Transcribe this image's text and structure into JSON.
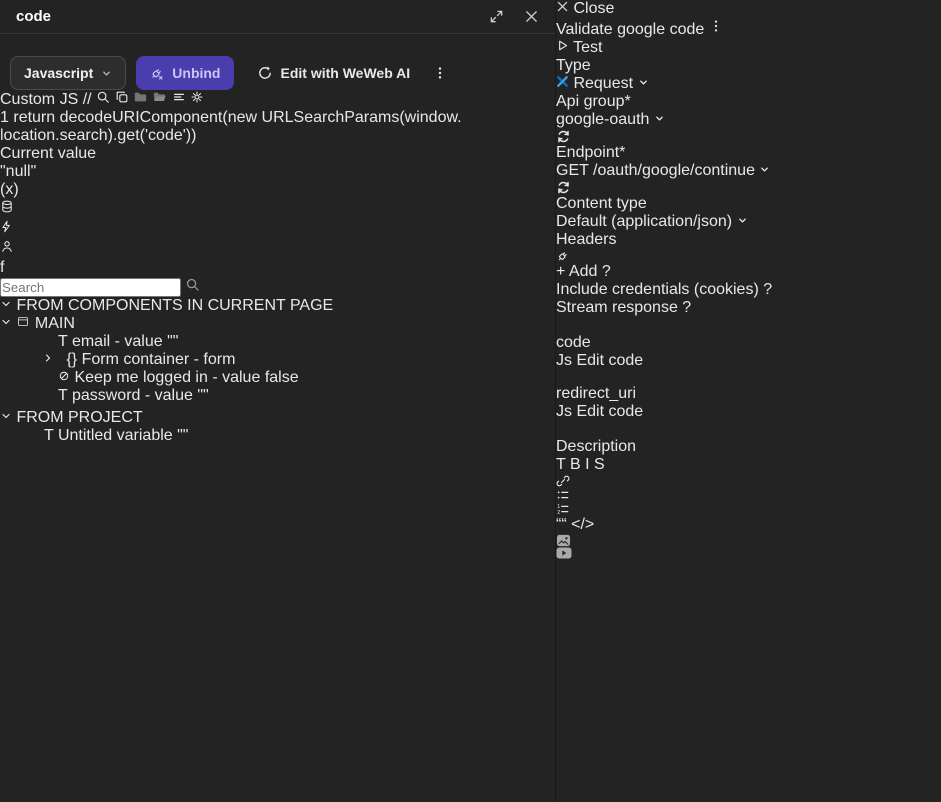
{
  "left_panel": {
    "header": {
      "title": "code"
    },
    "toolbar": {
      "language": "Javascript",
      "unbind": "Unbind",
      "ai": "Edit with WeWeb AI"
    },
    "custom_js": {
      "label": "Custom JS",
      "comment_glyph": "//",
      "line_number": "1",
      "icon_names": [
        "comment-icon",
        "search-icon",
        "copy-icon",
        "folder-icon",
        "folder-open-icon",
        "format-lines-icon",
        "gear-icon"
      ],
      "code_lines": [
        [
          {
            "t": "return",
            "c": "kw"
          },
          {
            "t": " ",
            "c": "pl"
          },
          {
            "t": "decodeURIComponent",
            "c": "pl"
          },
          {
            "t": "(",
            "c": "b1"
          },
          {
            "t": "new",
            "c": "kw"
          },
          {
            "t": " ",
            "c": "pl"
          },
          {
            "t": "URLSearchParams",
            "c": "cls"
          },
          {
            "t": "(",
            "c": "b2"
          },
          {
            "t": "window.",
            "c": "pl"
          }
        ],
        [
          {
            "t": "location.search",
            "c": "pl"
          },
          {
            "t": ")",
            "c": "b2"
          },
          {
            "t": ".",
            "c": "pl"
          },
          {
            "t": "get",
            "c": "meth"
          },
          {
            "t": "(",
            "c": "b1"
          },
          {
            "t": "'code'",
            "c": "str"
          },
          {
            "t": ")",
            "c": "b1"
          },
          {
            "t": ")",
            "c": "b2"
          }
        ]
      ]
    },
    "current_value": {
      "label": "Current value",
      "value": "\"null\""
    },
    "tabs": {
      "formula_glyph": "(x)",
      "function_glyph": "f",
      "icon_names": [
        "formula-tab",
        "database-icon",
        "lightning-icon",
        "person-icon",
        "function-italic-f"
      ]
    },
    "search": {
      "placeholder": "Search"
    },
    "tree": {
      "section1": "FROM COMPONENTS IN CURRENT PAGE",
      "group_main": "MAIN",
      "email": {
        "icon_glyph": "T",
        "label": "email - value",
        "value": "\"\""
      },
      "form_container": {
        "icon_glyph": "{}",
        "label": "Form container - form"
      },
      "keep_logged": {
        "label": "Keep me logged in - value",
        "value": "false"
      },
      "password": {
        "icon_glyph": "T",
        "label": "password - value",
        "value": "\"\""
      },
      "section2": "FROM PROJECT",
      "untitled": {
        "icon_glyph": "T",
        "label": "Untitled variable",
        "value": "\"\""
      }
    }
  },
  "right_panel": {
    "close": "Close",
    "header": {
      "title": "Validate google code",
      "test": "Test"
    },
    "form": {
      "type": {
        "label": "Type",
        "value": "Request"
      },
      "api_group": {
        "label": "Api group",
        "required": "*",
        "value": "google-oauth"
      },
      "endpoint": {
        "label": "Endpoint",
        "required": "*",
        "value": "GET /oauth/google/continue"
      },
      "content_type": {
        "label": "Content type",
        "value": "Default (application/json)"
      },
      "headers": {
        "label": "Headers",
        "add": "+ Add",
        "help_glyph": "?"
      },
      "toggle_credentials": "Include credentials (cookies)",
      "toggle_stream": "Stream response",
      "code_field": {
        "label": "code",
        "js_glyph": "Js",
        "button": "Edit code"
      },
      "redirect_field": {
        "label": "redirect_uri",
        "js_glyph": "Js",
        "button": "Edit code"
      },
      "description": {
        "label": "Description",
        "t_glyph": "T",
        "bold_glyph": "B",
        "italic_glyph": "I",
        "strike_glyph": "S",
        "quote_glyph": "““",
        "code_glyph": "</>"
      }
    }
  }
}
